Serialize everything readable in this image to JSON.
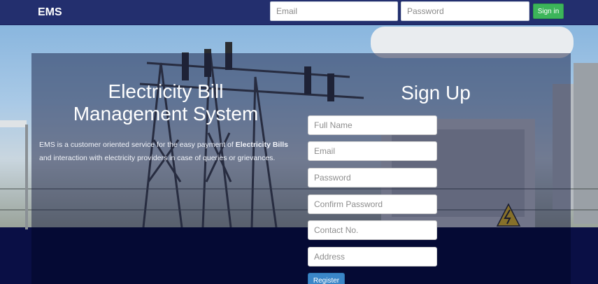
{
  "navbar": {
    "brand": "EMS",
    "email_placeholder": "Email",
    "password_placeholder": "Password",
    "signin_label": "Sign in"
  },
  "hero": {
    "title_line1": "Electricity Bill",
    "title_line2": "Management System",
    "desc_part1": "EMS is a customer oriented service for the easy payment of ",
    "desc_bold": "Electricity Bills",
    "desc_part2": " and interaction with electricity providers in case of queries or grievances."
  },
  "signup": {
    "title": "Sign Up",
    "full_name_placeholder": "Full Name",
    "email_placeholder": "Email",
    "password_placeholder": "Password",
    "confirm_password_placeholder": "Confirm Password",
    "contact_placeholder": "Contact No.",
    "address_placeholder": "Address",
    "register_label": "Register"
  },
  "colors": {
    "navbar": "#232f6e",
    "signin_button": "#3cb55a",
    "register_button": "#3a86c8",
    "panel_lower": "#050a34"
  }
}
